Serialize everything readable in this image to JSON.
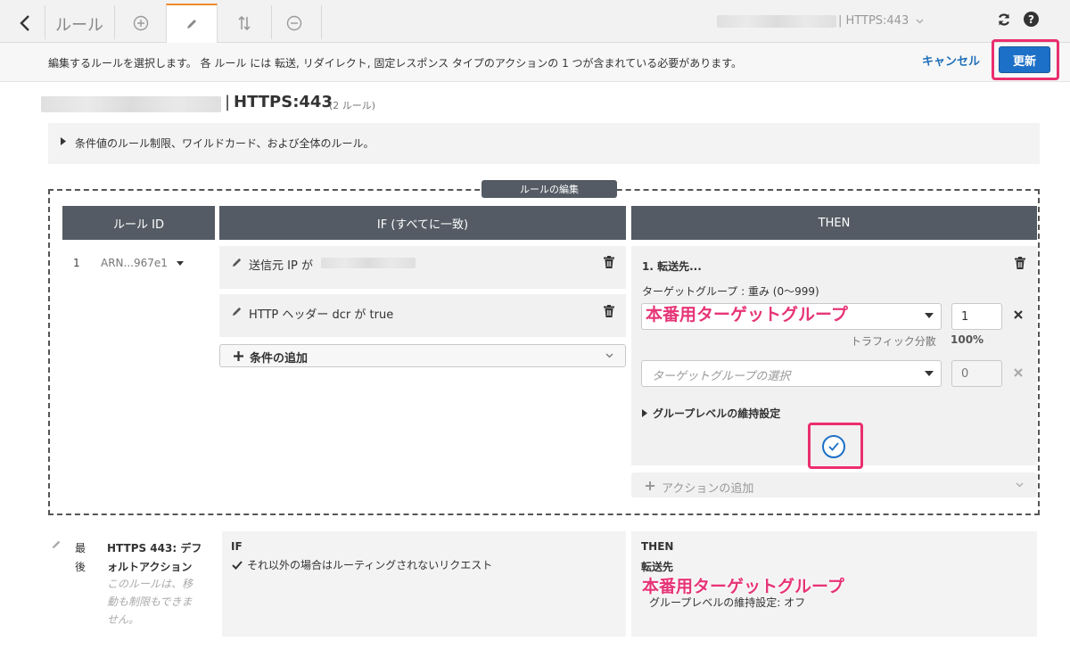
{
  "tabbar": {
    "title": "ルール",
    "listener": "| HTTPS:443"
  },
  "infobar": {
    "message": "編集するルールを選択します。 各 ルール には 転送, リダイレクト, 固定レスポンス タイプのアクションの 1 つが含まれている必要があります。",
    "cancel_label": "キャンセル",
    "update_label": "更新"
  },
  "heading": {
    "separator": "|",
    "title": "HTTPS:443",
    "rule_count": "(2 ルール)"
  },
  "note": {
    "text": "条件値のルール制限、ワイルドカード、および全体のルール。"
  },
  "editor": {
    "section_label": "ルールの編集",
    "columns": {
      "rule_id": "ルール ID",
      "if": "IF (すべてに一致)",
      "then": "THEN"
    },
    "rule": {
      "number": "1",
      "arn": "ARN...967e1"
    },
    "conditions": [
      {
        "text": "送信元 IP が"
      },
      {
        "text": "HTTP ヘッダー dcr が true"
      }
    ],
    "add_condition_label": "条件の追加",
    "action": {
      "title": "1. 転送先...",
      "weight_label": "ターゲットグループ : 重み (0〜999)",
      "target_1": "本番用ターゲットグループ",
      "weight_1": "1",
      "traffic_label": "トラフィック分散",
      "traffic_value": "100%",
      "target_2_placeholder": "ターゲットグループの選択",
      "weight_2": "0",
      "stickiness_label": "グループレベルの維持設定"
    },
    "add_action_label": "アクションの追加"
  },
  "default_rule": {
    "order_1": "最",
    "order_2": "後",
    "name_1": "HTTPS 443: デフ",
    "name_2": "ォルトアクション",
    "desc_1": "このルールは、移",
    "desc_2": "動も制限もできま",
    "desc_3": "せん。",
    "if_header": "IF",
    "if_text": "それ以外の場合はルーティングされないリクエスト",
    "then_header": "THEN",
    "then_action": "転送先",
    "then_target": "本番用ターゲットグループ",
    "then_stickiness": "グループレベルの維持設定: オフ"
  },
  "colors": {
    "accent": "#1d70c7",
    "highlight": "#ea2e6e",
    "tab_active": "#f08b2d",
    "header_bg": "#545b64"
  }
}
